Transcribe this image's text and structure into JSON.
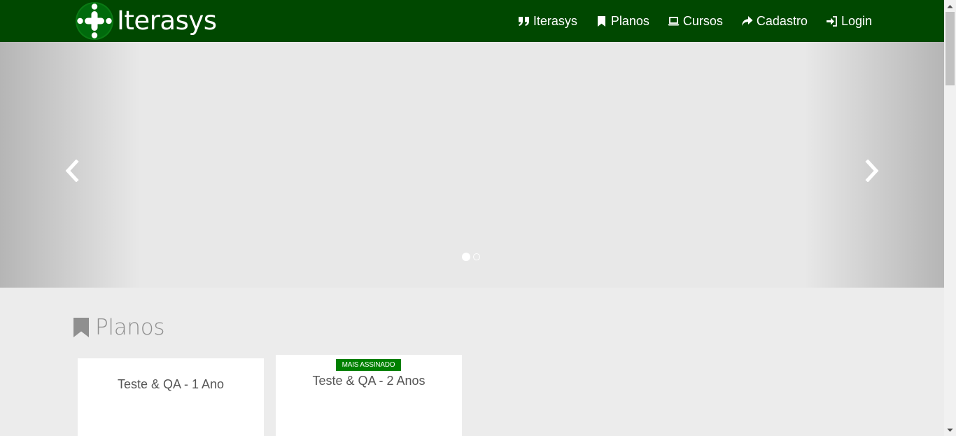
{
  "colors": {
    "navbar_bg": "#004800",
    "badge_bg": "#008000",
    "carousel_bg": "#e8e8e8",
    "page_bg": "#ececec"
  },
  "navbar": {
    "brand": {
      "logo_icon": "iterasys-cross-logo-icon",
      "name": "Iterasys"
    },
    "links": [
      {
        "icon": "quote-icon",
        "label": "Iterasys"
      },
      {
        "icon": "bookmark-icon",
        "label": "Planos"
      },
      {
        "icon": "laptop-icon",
        "label": "Cursos"
      },
      {
        "icon": "share-arrow-icon",
        "label": "Cadastro"
      },
      {
        "icon": "sign-in-icon",
        "label": "Login"
      }
    ]
  },
  "carousel": {
    "prev_icon": "chevron-left-icon",
    "next_icon": "chevron-right-icon",
    "slide_count": 2,
    "active_slide": 1
  },
  "plans": {
    "heading_icon": "bookmark-icon",
    "heading": "Planos",
    "cards": [
      {
        "name": "Teste & QA - 1 Ano"
      },
      {
        "name": "Teste & QA - 2 Anos",
        "badge": "MAIS ASSINADO"
      }
    ]
  }
}
